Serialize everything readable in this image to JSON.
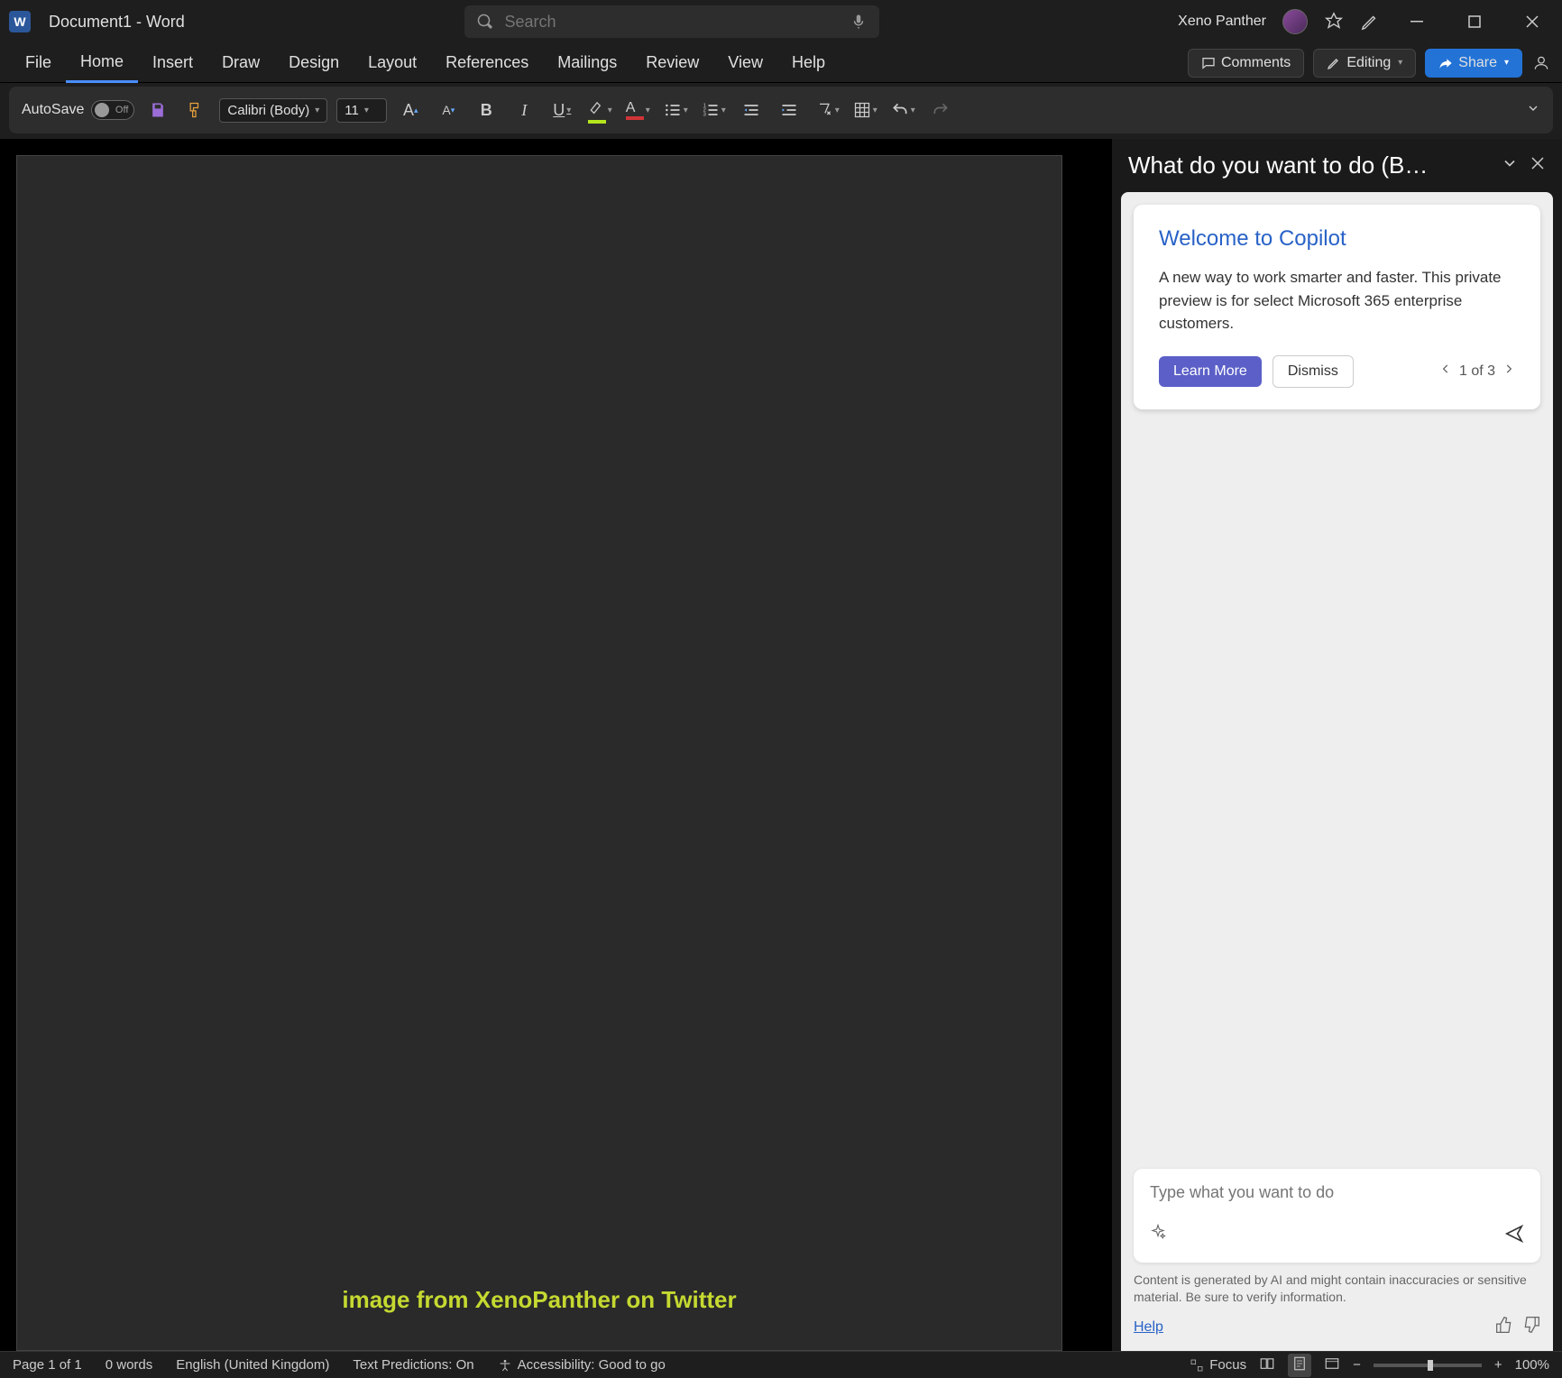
{
  "titlebar": {
    "app_letter": "W",
    "doc_title": "Document1  -  Word",
    "search_placeholder": "Search",
    "username": "Xeno Panther"
  },
  "ribbon": {
    "tabs": [
      "File",
      "Home",
      "Insert",
      "Draw",
      "Design",
      "Layout",
      "References",
      "Mailings",
      "Review",
      "View",
      "Help"
    ],
    "active_tab": "Home",
    "comments": "Comments",
    "editing": "Editing",
    "share": "Share"
  },
  "toolbar": {
    "autosave_label": "AutoSave",
    "autosave_state": "Off",
    "font_name": "Calibri (Body)",
    "font_size": "11"
  },
  "document": {
    "watermark": "image from XenoPanther on Twitter"
  },
  "copilot": {
    "panel_title": "What do you want to do (B…",
    "card_title": "Welcome to Copilot",
    "card_text": "A new way to work smarter and faster. This private preview is for select Microsoft 365 enterprise customers.",
    "learn_more": "Learn More",
    "dismiss": "Dismiss",
    "pager": "1 of 3",
    "input_placeholder": "Type what you want to do",
    "disclaimer": "Content is generated by AI and might contain inaccuracies or sensitive material. Be sure to verify information.",
    "help": "Help"
  },
  "statusbar": {
    "page": "Page 1 of 1",
    "words": "0 words",
    "language": "English (United Kingdom)",
    "predictions": "Text Predictions: On",
    "accessibility": "Accessibility: Good to go",
    "focus": "Focus",
    "zoom": "100%"
  },
  "colors": {
    "highlight": "#ffff00",
    "font_color": "#d13438"
  }
}
